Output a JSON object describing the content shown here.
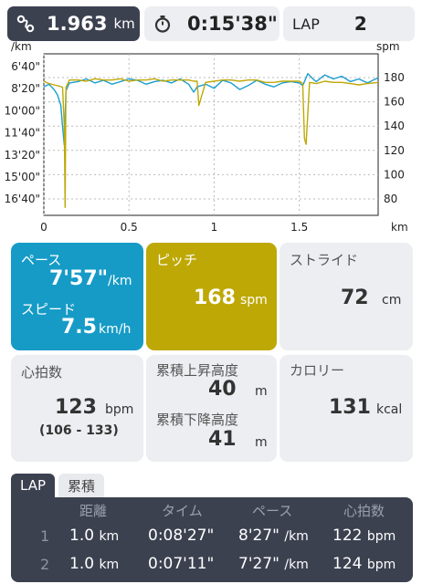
{
  "top": {
    "distance_value": "1.963",
    "distance_unit": "km",
    "time_value": "0:15'38\"",
    "lap_label": "LAP",
    "lap_value": "2"
  },
  "chart_data": {
    "type": "line",
    "left_axis_label": "/km",
    "right_axis_label": "spm",
    "x_axis_label": "km",
    "x_ticks": [
      "0",
      "0.5",
      "1",
      "1.5"
    ],
    "xlim": [
      0,
      1.963
    ],
    "left_ticks": [
      "6'40\"",
      "8'20\"",
      "10'00\"",
      "11'40\"",
      "13'20\"",
      "15'00\"",
      "16'40\""
    ],
    "right_ticks": [
      "180",
      "160",
      "140",
      "120",
      "100",
      "80"
    ],
    "ylim_right": [
      70,
      185
    ],
    "series": [
      {
        "color": "#1a9ed0",
        "axis": "left",
        "x": [
          0,
          0.03,
          0.06,
          0.08,
          0.1,
          0.11,
          0.12,
          0.13,
          0.15,
          0.2,
          0.25,
          0.3,
          0.35,
          0.4,
          0.45,
          0.5,
          0.55,
          0.6,
          0.65,
          0.7,
          0.75,
          0.8,
          0.85,
          0.88,
          0.9,
          0.95,
          1.0,
          1.05,
          1.1,
          1.15,
          1.2,
          1.25,
          1.3,
          1.35,
          1.4,
          1.45,
          1.5,
          1.52,
          1.55,
          1.58,
          1.6,
          1.65,
          1.7,
          1.75,
          1.8,
          1.85,
          1.9,
          1.963
        ],
        "values": [
          8.2,
          8.0,
          8.4,
          8.8,
          9.6,
          11.2,
          12.6,
          8.5,
          7.9,
          7.8,
          7.6,
          7.9,
          7.7,
          8.0,
          7.8,
          7.6,
          7.7,
          8.0,
          7.8,
          7.7,
          7.9,
          7.6,
          8.0,
          8.6,
          8.2,
          8.0,
          8.3,
          7.7,
          7.9,
          8.4,
          8.1,
          7.7,
          8.0,
          8.2,
          7.9,
          7.8,
          7.9,
          8.1,
          7.2,
          7.6,
          7.8,
          7.3,
          7.6,
          7.4,
          7.8,
          7.6,
          7.9,
          7.5
        ]
      },
      {
        "color": "#bea806",
        "axis": "right",
        "x": [
          0,
          0.03,
          0.06,
          0.09,
          0.11,
          0.12,
          0.125,
          0.13,
          0.15,
          0.2,
          0.25,
          0.3,
          0.35,
          0.4,
          0.45,
          0.5,
          0.55,
          0.6,
          0.65,
          0.7,
          0.75,
          0.8,
          0.85,
          0.88,
          0.9,
          0.91,
          0.95,
          1.0,
          1.05,
          1.1,
          1.15,
          1.2,
          1.25,
          1.3,
          1.35,
          1.4,
          1.5,
          1.52,
          1.53,
          1.54,
          1.56,
          1.6,
          1.65,
          1.7,
          1.75,
          1.8,
          1.85,
          1.9,
          1.963
        ],
        "values": [
          177,
          175,
          174,
          173,
          172,
          140,
          73,
          172,
          178,
          178,
          177,
          179,
          178,
          178,
          179,
          177,
          178,
          178,
          179,
          177,
          178,
          178,
          178,
          177,
          177,
          157,
          176,
          177,
          178,
          178,
          177,
          178,
          178,
          176,
          176,
          177,
          177,
          175,
          130,
          125,
          176,
          175,
          177,
          176,
          176,
          175,
          174,
          175,
          176
        ]
      }
    ]
  },
  "tiles": {
    "pace_label": "ペース",
    "pace_value": "7'57\"",
    "pace_unit": "/km",
    "speed_label": "スピード",
    "speed_value": "7.5",
    "speed_unit": "km/h",
    "pitch_label": "ピッチ",
    "pitch_value": "168",
    "pitch_unit": "spm",
    "stride_label": "ストライド",
    "stride_value": "72",
    "stride_unit": "cm",
    "hr_label": "心拍数",
    "hr_value": "123",
    "hr_unit": "bpm",
    "hr_range": "(106 - 133)",
    "ascent_label": "累積上昇高度",
    "ascent_value": "40",
    "ascent_unit": "m",
    "descent_label": "累積下降高度",
    "descent_value": "41",
    "descent_unit": "m",
    "calorie_label": "カロリー",
    "calorie_value": "131",
    "calorie_unit": "kcal"
  },
  "laps": {
    "tab_lap": "LAP",
    "tab_total": "累積",
    "headers": [
      "距離",
      "タイム",
      "ペース",
      "心拍数"
    ],
    "rows": [
      {
        "num": "1",
        "dist": "1.0",
        "dist_unit": "km",
        "time": "0:08'27\"",
        "pace": "8'27\"",
        "pace_unit": "/km",
        "hr": "122",
        "hr_unit": "bpm"
      },
      {
        "num": "2",
        "dist": "1.0",
        "dist_unit": "km",
        "time": "0:07'11\"",
        "pace": "7'27\"",
        "pace_unit": "/km",
        "hr": "124",
        "hr_unit": "bpm"
      }
    ]
  }
}
